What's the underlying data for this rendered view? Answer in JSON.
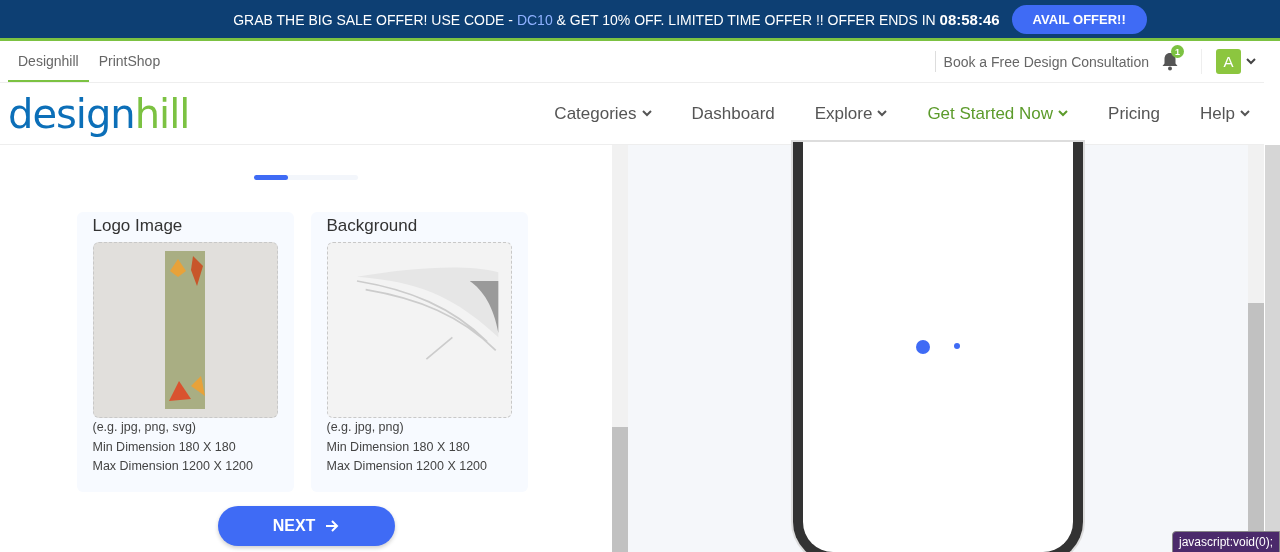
{
  "promo": {
    "text_before": "GRAB THE BIG SALE OFFER! USE CODE - ",
    "code": "DC10",
    "text_after": " & GET 10% OFF. LIMITED TIME OFFER !! OFFER ENDS IN ",
    "countdown": "08:58:46",
    "button": "AVAIL OFFER!!"
  },
  "site_tabs": [
    {
      "label": "Designhill",
      "selected": true
    },
    {
      "label": "PrintShop",
      "selected": false
    }
  ],
  "consultation_link": "Book a Free Design Consultation",
  "notifications": {
    "count": "1"
  },
  "avatar": {
    "initial": "A"
  },
  "logo": {
    "part_1": "design",
    "part_2": "hill"
  },
  "nav": [
    {
      "label": "Categories",
      "dropdown": true,
      "highlight": false
    },
    {
      "label": "Dashboard",
      "dropdown": false,
      "highlight": false
    },
    {
      "label": "Explore",
      "dropdown": true,
      "highlight": false
    },
    {
      "label": "Get Started Now",
      "dropdown": true,
      "highlight": true
    },
    {
      "label": "Pricing",
      "dropdown": false,
      "highlight": false
    },
    {
      "label": "Help",
      "dropdown": true,
      "highlight": false
    }
  ],
  "progress": {
    "level": 0.33
  },
  "uploads": [
    {
      "title": "Logo Image",
      "kind": "bookmark",
      "formats": "(e.g. jpg, png, svg)",
      "min": "Min Dimension 180 X 180",
      "max": "Max Dimension 1200 X 1200"
    },
    {
      "title": "Background",
      "kind": "book",
      "formats": "(e.g. jpg, png)",
      "min": "Min Dimension 180 X 180",
      "max": "Max Dimension 1200 X 1200"
    }
  ],
  "next_button": "NEXT",
  "status_tooltip": "javascript:void(0);"
}
